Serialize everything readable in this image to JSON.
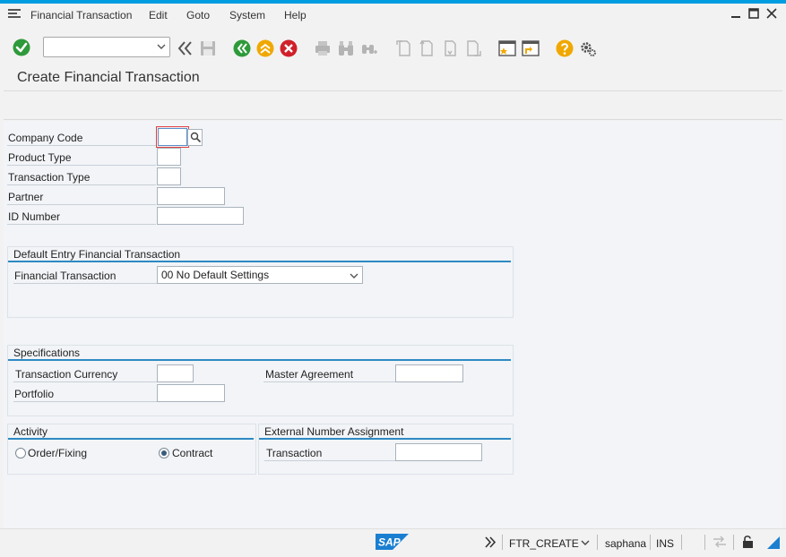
{
  "menu": {
    "items": [
      "Financial Transaction",
      "Edit",
      "Goto",
      "System",
      "Help"
    ]
  },
  "toolbar": {
    "command_value": ""
  },
  "page": {
    "title": "Create Financial Transaction"
  },
  "header_fields": [
    {
      "label": "Company Code",
      "value": ""
    },
    {
      "label": "Product Type",
      "value": ""
    },
    {
      "label": "Transaction Type",
      "value": ""
    },
    {
      "label": "Partner",
      "value": ""
    },
    {
      "label": "ID Number",
      "value": ""
    }
  ],
  "default_entry": {
    "title": "Default Entry Financial Transaction",
    "label": "Financial Transaction",
    "selected": "00 No Default Settings"
  },
  "specifications": {
    "title": "Specifications",
    "transaction_currency_label": "Transaction Currency",
    "portfolio_label": "Portfolio",
    "master_agreement_label": "Master Agreement"
  },
  "activity": {
    "title": "Activity",
    "options": [
      {
        "label": "Order/Fixing",
        "selected": false
      },
      {
        "label": "Contract",
        "selected": true
      }
    ]
  },
  "external_number": {
    "title": "External Number Assignment",
    "transaction_label": "Transaction"
  },
  "statusbar": {
    "logo": "SAP",
    "transaction": "FTR_CREATE",
    "user": "saphana",
    "mode": "INS"
  },
  "colors": {
    "accent": "#009de0",
    "group_line": "#2d8ac4",
    "ok_green": "#2e9a3a",
    "nav_green": "#2e9a3a",
    "nav_orange": "#f0a800",
    "nav_red": "#d0202a",
    "help_yellow": "#f0a800"
  }
}
